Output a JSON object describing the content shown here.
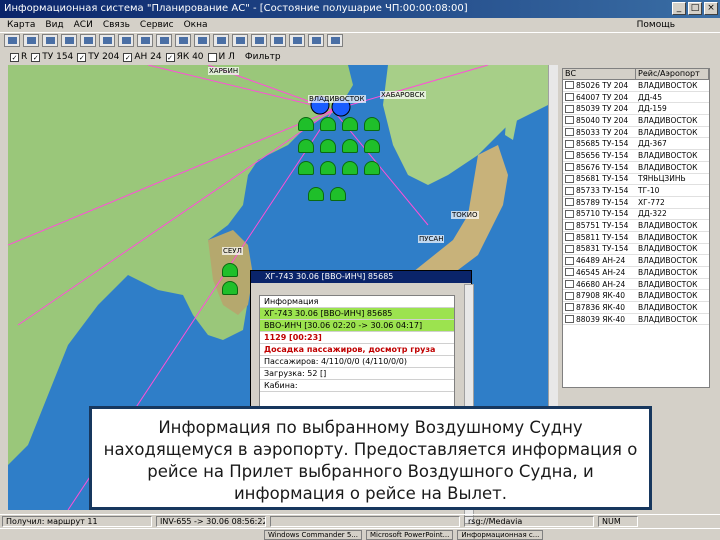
{
  "window": {
    "title": "Информационная система \"Планирование АС\" - [Состояние полушарие ЧП:00:00:08:00]",
    "minimize": "_",
    "maximize": "□",
    "close": "×"
  },
  "menu": {
    "items": [
      "Карта",
      "Вид",
      "АСИ",
      "Связь",
      "Сервис",
      "Окна"
    ],
    "help": "Помощь"
  },
  "filters": {
    "items": [
      {
        "label": "R",
        "checked": true
      },
      {
        "label": "ТУ 154",
        "checked": true
      },
      {
        "label": "ТУ 204",
        "checked": true
      },
      {
        "label": "АН 24",
        "checked": true
      },
      {
        "label": "ЯК 40",
        "checked": true
      },
      {
        "label": "И Л",
        "checked": false
      }
    ],
    "filter_label": "Фильтр"
  },
  "map": {
    "labels": [
      "ХАРБИН",
      "ВЛАДИВОСТОК",
      "ХАБАРОВСК",
      "ТОКИО",
      "СЕУЛ",
      "ПУСАН"
    ]
  },
  "flight_list": {
    "columns": [
      "ВС",
      "Рейс/Аэропорт"
    ],
    "rows": [
      {
        "bc": "85026 ТУ 204",
        "route": "ВЛАДИВОСТОК"
      },
      {
        "bc": "64007 ТУ 204",
        "route": "ДД-45"
      },
      {
        "bc": "85039 ТУ 204",
        "route": "ДД-159"
      },
      {
        "bc": "85040 ТУ 204",
        "route": "ВЛАДИВОСТОК"
      },
      {
        "bc": "85033 ТУ 204",
        "route": "ВЛАДИВОСТОК"
      },
      {
        "bc": "85685 ТУ-154",
        "route": "ДД-367"
      },
      {
        "bc": "85656 ТУ-154",
        "route": "ВЛАДИВОСТОК"
      },
      {
        "bc": "85676 ТУ-154",
        "route": "ВЛАДИВОСТОК"
      },
      {
        "bc": "85681 ТУ-154",
        "route": "ТЯНЬЦЗИНЬ"
      },
      {
        "bc": "85733 ТУ-154",
        "route": "ТГ-10"
      },
      {
        "bc": "85789 ТУ-154",
        "route": "ХГ-772"
      },
      {
        "bc": "85710 ТУ-154",
        "route": "ДД-322"
      },
      {
        "bc": "85751 ТУ-154",
        "route": "ВЛАДИВОСТОК"
      },
      {
        "bc": "85811 ТУ-154",
        "route": "ВЛАДИВОСТОК"
      },
      {
        "bc": "85831 ТУ-154",
        "route": "ВЛАДИВОСТОК"
      },
      {
        "bc": "46489 АН-24",
        "route": "ВЛАДИВОСТОК"
      },
      {
        "bc": "46545 АН-24",
        "route": "ВЛАДИВОСТОК"
      },
      {
        "bc": "46680 АН-24",
        "route": "ВЛАДИВОСТОК"
      },
      {
        "bc": "87908 ЯК-40",
        "route": "ВЛАДИВОСТОК"
      },
      {
        "bc": "87836 ЯК-40",
        "route": "ВЛАДИВОСТОК"
      },
      {
        "bc": "88039 ЯК-40",
        "route": "ВЛАДИВОСТОК"
      }
    ]
  },
  "info_window": {
    "title": "ХГ-743 30.06 [ВВО-ИНЧ] 85685",
    "rows": [
      {
        "text": "Информация",
        "style": "plain"
      },
      {
        "text": "ХГ-743 30.06 [ВВО-ИНЧ] 85685",
        "style": "green"
      },
      {
        "text": "ВВО-ИНЧ [30.06 02:20 -> 30.06 04:17]",
        "style": "green"
      },
      {
        "text": "1129 [00:23]",
        "style": "red"
      },
      {
        "text": "Досадка пассажиров, досмотр груза",
        "style": "red"
      },
      {
        "text": "Пассажиров: 4/110/0/0 (4/110/0/0)",
        "style": "plain"
      },
      {
        "text": "Загрузка: 52 []",
        "style": "plain"
      },
      {
        "text": "Кабина:",
        "style": "plain"
      }
    ]
  },
  "callout": {
    "text": "Информация по выбранному Воздушному Судну находящемуся в аэропорту. Предоставляется информация о рейсе на Прилет выбранного Воздушного Судна, и информация о рейсе на Вылет."
  },
  "statusbar": {
    "left": "Получил: маршрут 11",
    "middle": "INV-655 -> 30.06 08:56:22",
    "right_path": "rsg://Medavia",
    "num": "NUM"
  },
  "taskbar": {
    "items": [
      "Windows Commander 5...",
      "Microsoft PowerPoint...",
      "Информационная с..."
    ]
  },
  "colors": {
    "sea": "#2f7ec8",
    "land": "#9ac77a",
    "plane_green": "#1fbf2a",
    "callout_border": "#17375e",
    "info_green": "#9ce34f"
  }
}
